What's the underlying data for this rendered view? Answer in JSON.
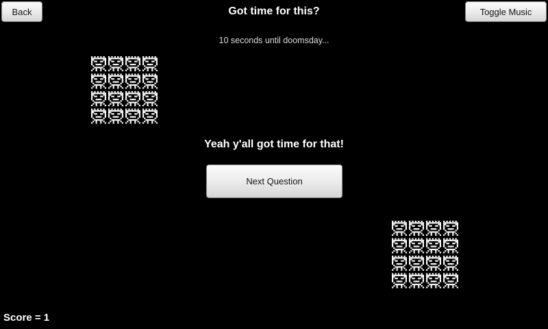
{
  "header": {
    "back_label": "Back",
    "title": "Got time for this?",
    "music_label": "Toggle Music"
  },
  "game": {
    "countdown": "10 seconds until doomsday...",
    "answer_text": "Yeah y'all got time for that!",
    "next_label": "Next Question",
    "score_text": "Score = 1",
    "sprite_icon": "pixel-face-icon",
    "sprite_grids": [
      {
        "rows": 4,
        "cols": 4
      },
      {
        "rows": 4,
        "cols": 4
      }
    ]
  },
  "colors": {
    "background": "#000000",
    "text": "#ffffff",
    "button_top": "#fbfbfb",
    "button_bottom": "#d6d6d6"
  }
}
